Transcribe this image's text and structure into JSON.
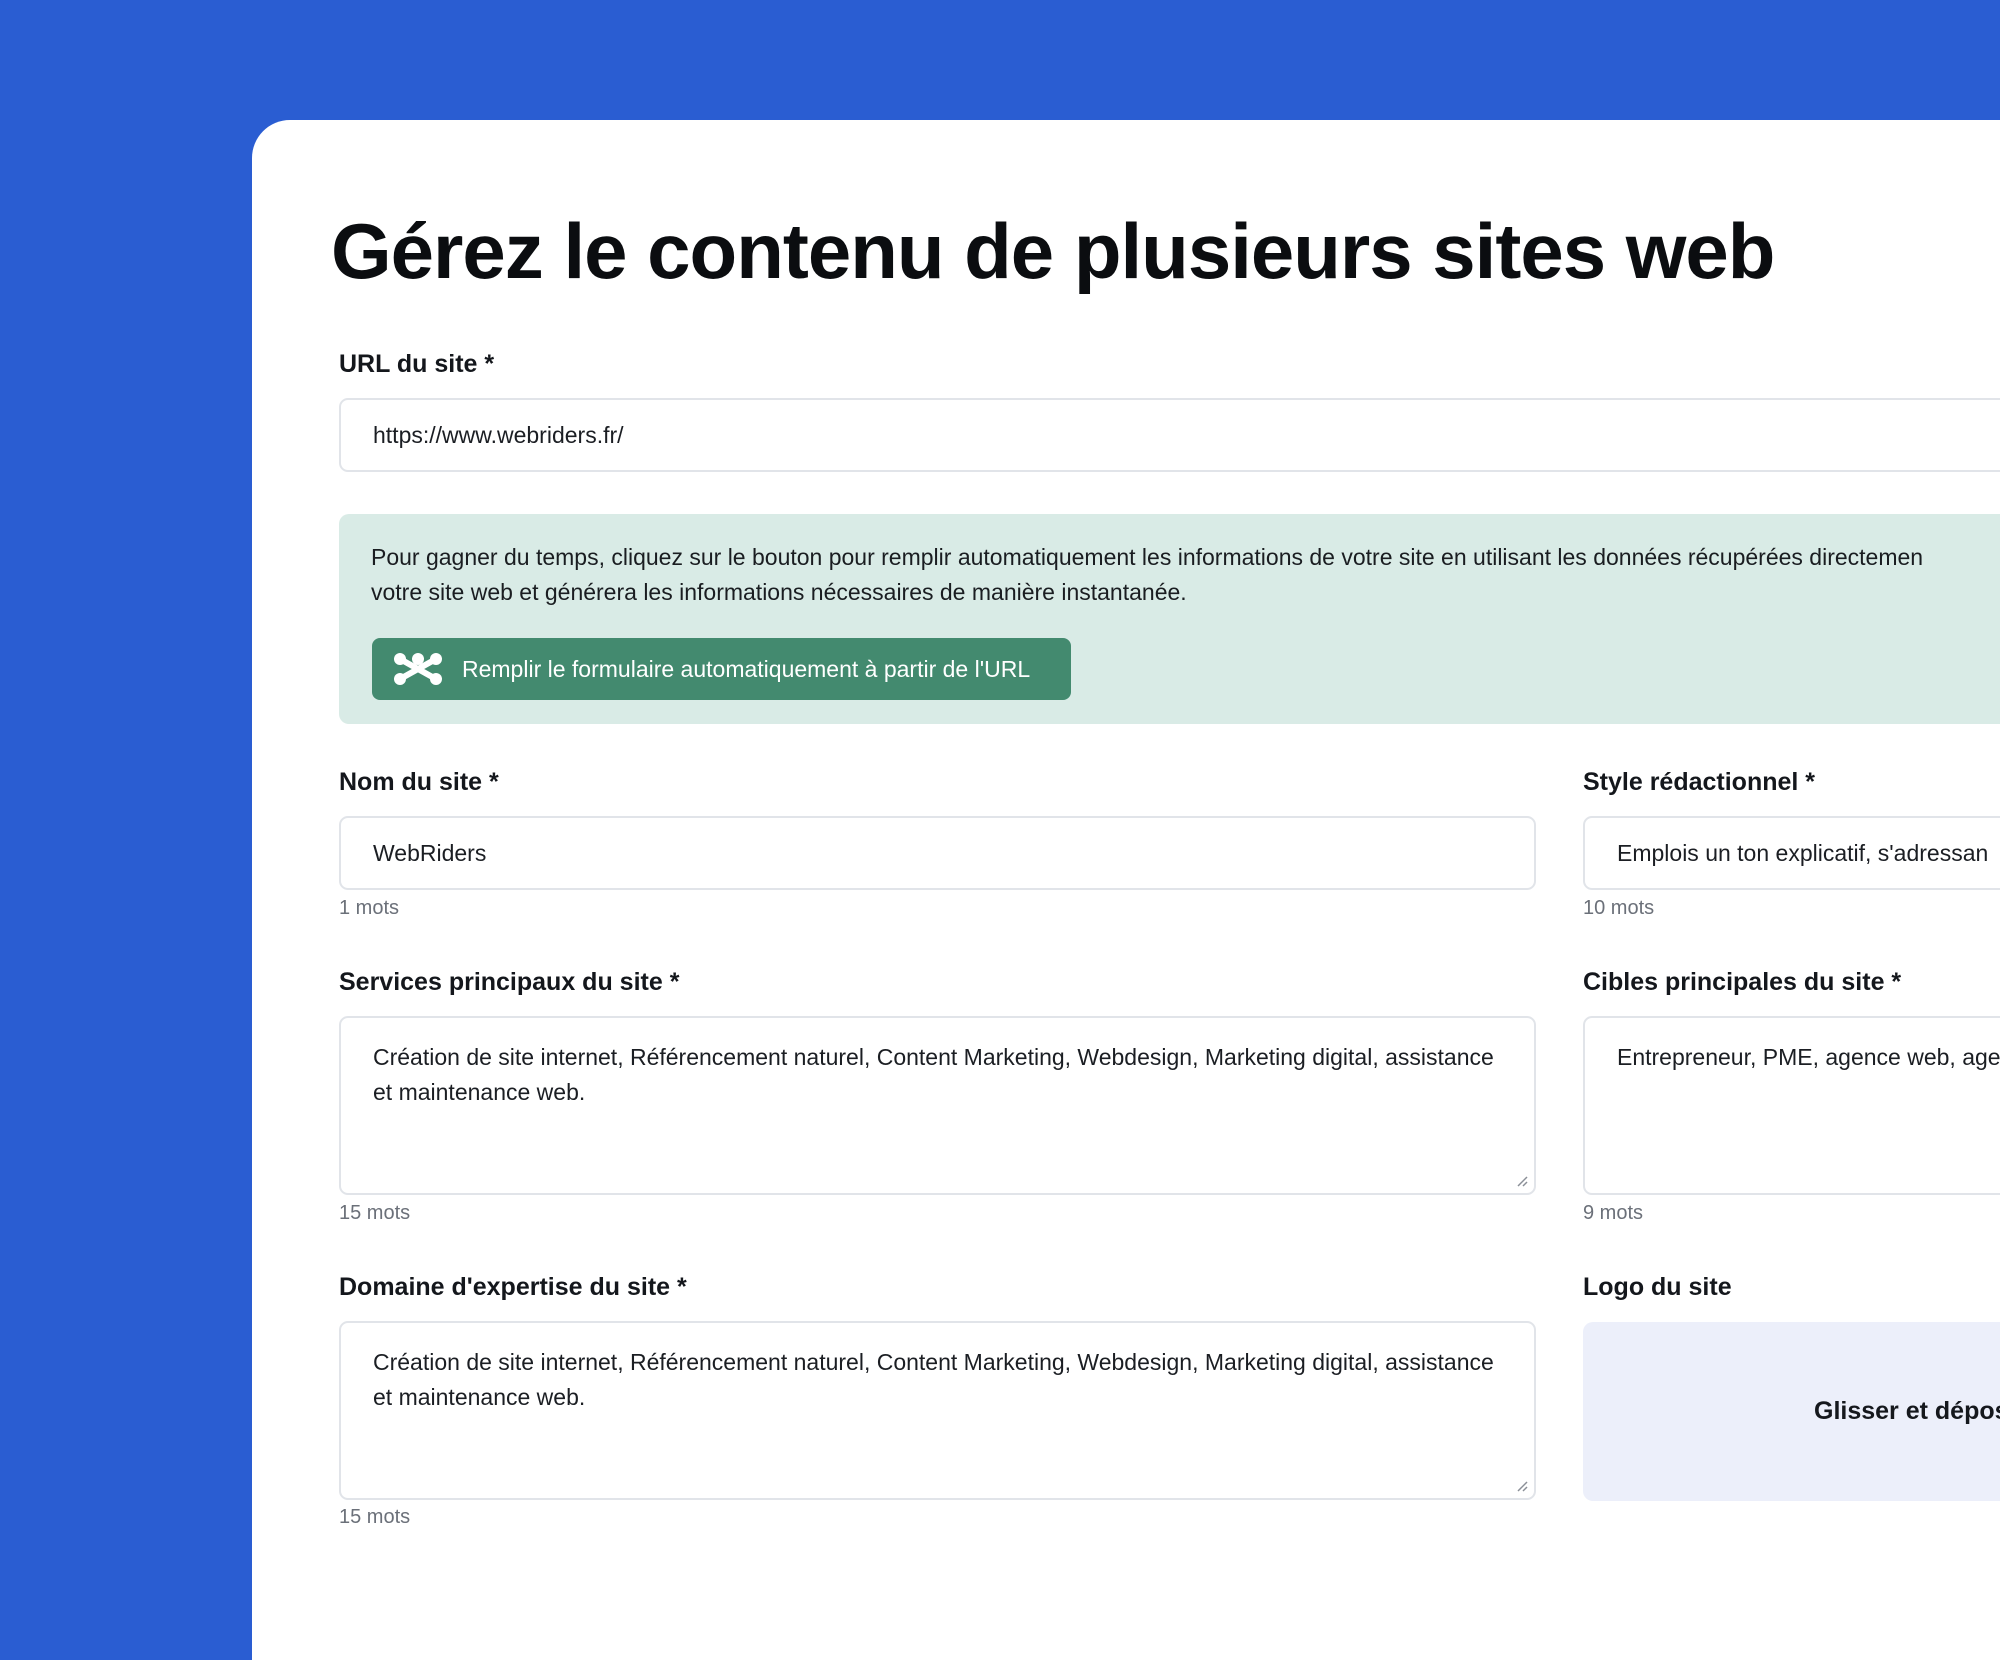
{
  "page": {
    "title": "Gérez le contenu de plusieurs sites web"
  },
  "url_field": {
    "label": "URL du site *",
    "value": "https://www.webriders.fr/"
  },
  "autofill": {
    "text_line1": "Pour gagner du temps, cliquez sur le bouton pour remplir automatiquement les informations de votre site en utilisant les données récupérées directemen",
    "text_line2": "votre site web et générera les informations nécessaires de manière instantanée.",
    "button_label": "Remplir le formulaire automatiquement à partir de l'URL",
    "button_icon": "nodes-icon"
  },
  "site_name": {
    "label": "Nom du site *",
    "value": "WebRiders",
    "count": "1 mots"
  },
  "writing_style": {
    "label": "Style rédactionnel *",
    "value": "Emplois un ton explicatif, s'adressan",
    "count": "10 mots"
  },
  "main_services": {
    "label": "Services principaux du site *",
    "value": "Création de site internet, Référencement naturel, Content Marketing, Webdesign, Marketing digital, assistance et maintenance web.",
    "count": "15 mots"
  },
  "main_targets": {
    "label": "Cibles principales du site *",
    "value": "Entrepreneur, PME, agence web, age",
    "count": "9 mots"
  },
  "expertise": {
    "label": "Domaine d'expertise du site *",
    "value": "Création de site internet, Référencement naturel, Content Marketing, Webdesign, Marketing digital, assistance et maintenance web.",
    "count": "15 mots"
  },
  "logo": {
    "label": "Logo du site",
    "dropzone_text": "Glisser et dépos"
  },
  "colors": {
    "background": "#2a5dd2",
    "card": "#ffffff",
    "info_box": "#d9ebe6",
    "button": "#438a6f",
    "dropzone": "#eceffa"
  }
}
